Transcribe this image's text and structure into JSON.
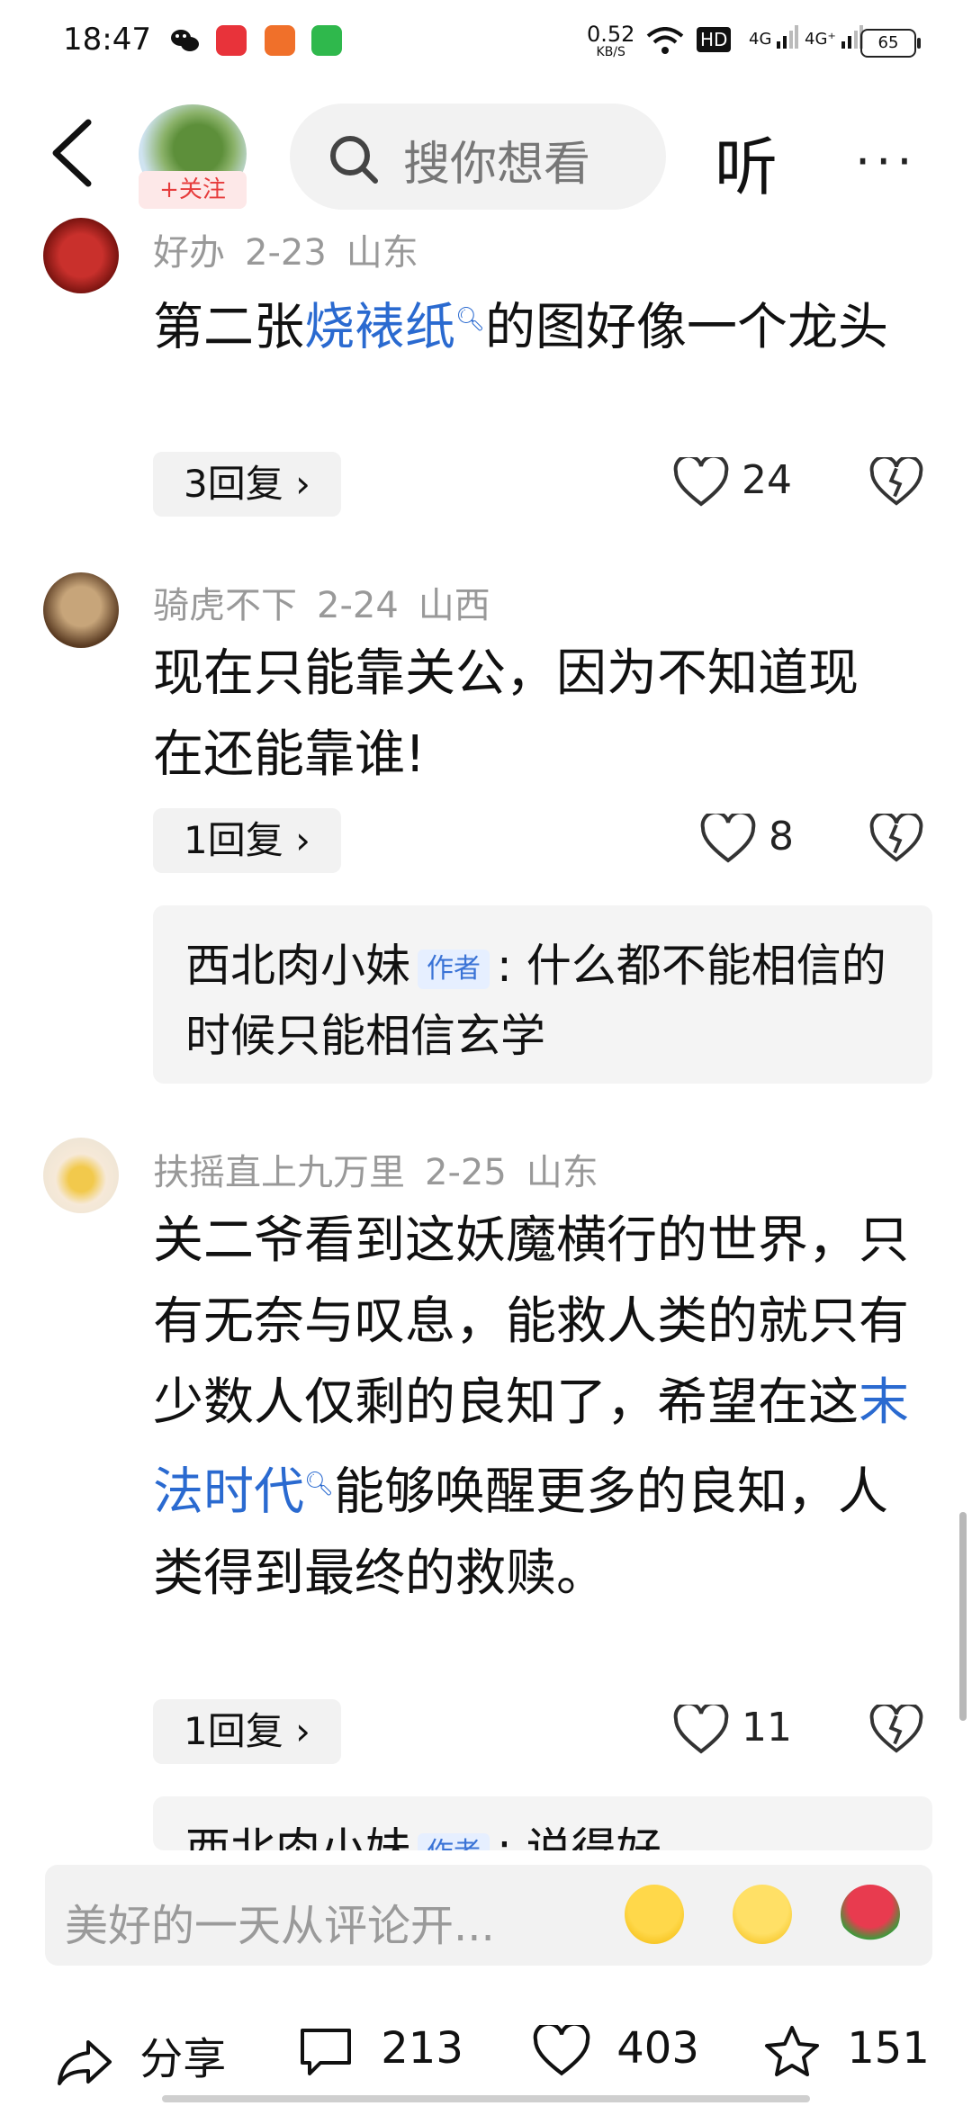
{
  "status": {
    "time": "18:47",
    "net_speed_value": "0.52",
    "net_speed_unit": "KB/S",
    "hd": "HD",
    "signal1": "4G",
    "signal2": "4G⁺",
    "battery": "65"
  },
  "header": {
    "follow_label": "+关注",
    "search_placeholder": "搜你想看",
    "listen_label": "听",
    "more_label": "···"
  },
  "comments": [
    {
      "user": "好办",
      "date": "2-23",
      "location": "山东",
      "text_before": "第二张",
      "link": "烧裱纸",
      "text_after": "的图好像一个龙头",
      "replies_label": "3回复",
      "likes": "24"
    },
    {
      "user": "骑虎不下",
      "date": "2-24",
      "location": "山西",
      "text": "现在只能靠关公，因为不知道现在还能靠谁!",
      "replies_label": "1回复",
      "likes": "8",
      "reply_preview": {
        "user": "西北肉小妹",
        "tag": "作者",
        "text": ": 什么都不能相信的时候只能相信玄学"
      }
    },
    {
      "user": "扶摇直上九万里",
      "date": "2-25",
      "location": "山东",
      "text_before": "关二爷看到这妖魔横行的世界，只有无奈与叹息，能救人类的就只有少数人仅剩的良知了，希望在这",
      "link": "末法时代",
      "text_after": "能够唤醒更多的良知，人类得到最终的救赎。",
      "replies_label": "1回复",
      "likes": "11",
      "reply_preview": {
        "user": "西北肉小妹",
        "tag": "作者",
        "text": ": 说得好"
      }
    }
  ],
  "input": {
    "placeholder": "美好的一天从评论开..."
  },
  "bottom": {
    "share_label": "分享",
    "comment_count": "213",
    "like_count": "403",
    "fav_count": "151"
  },
  "colors": {
    "link": "#2a6ad0",
    "follow": "#e63b3b",
    "author_tag_bg": "#e6efff"
  }
}
